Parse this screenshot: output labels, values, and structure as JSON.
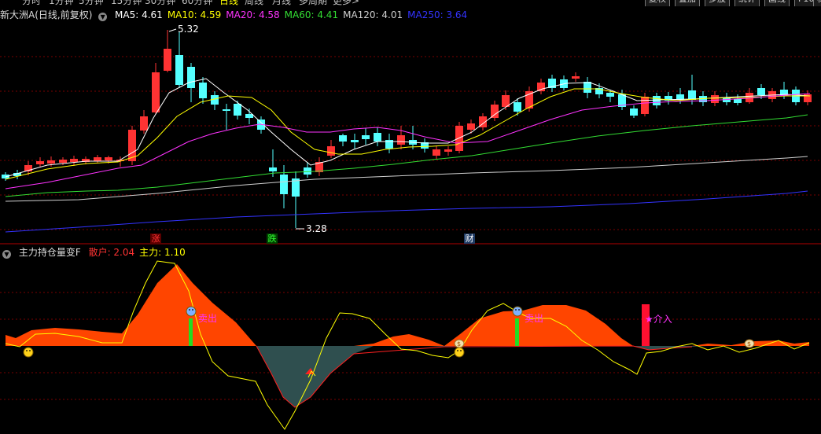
{
  "toolbar": {
    "periods": [
      "分时",
      "1分钟",
      "5分钟",
      "15分钟",
      "30分钟",
      "60分钟",
      "日线",
      "周线",
      "月线",
      "多周期",
      "更多>"
    ],
    "active_period": "日线",
    "right_buttons": [
      "复权",
      "叠加",
      "多股",
      "统计",
      "画线",
      "F10",
      "标"
    ]
  },
  "main_panel": {
    "stock_title": "新大洲A(日线,前复权)",
    "ma_legend": [
      {
        "label": "MA5: 4.61",
        "color": "#ffffff"
      },
      {
        "label": "MA10: 4.59",
        "color": "#ffff00"
      },
      {
        "label": "MA20: 4.58",
        "color": "#ff33ff"
      },
      {
        "label": "MA60: 4.41",
        "color": "#33dd33"
      },
      {
        "label": "MA120: 4.01",
        "color": "#d0d0d0"
      },
      {
        "label": "MA250: 3.64",
        "color": "#3333ff"
      }
    ],
    "high_mark": "5.32",
    "low_mark": "3.28",
    "tags": [
      {
        "text": "涨",
        "color": "#ff3333",
        "bg": "#5a0000"
      },
      {
        "text": "跌",
        "color": "#33ff33",
        "bg": "#004400"
      },
      {
        "text": "财",
        "color": "#ffffff",
        "bg": "#1f3c66"
      }
    ]
  },
  "indicator_panel": {
    "name": "主力持仓量变F",
    "values": [
      {
        "label": "散户: 2.04",
        "color": "#ff3333"
      },
      {
        "label": "主力: 1.10",
        "color": "#ffff00"
      }
    ],
    "annotations": [
      {
        "text": "卖出",
        "color": "#ff33ff"
      },
      {
        "text": "卖出",
        "color": "#ff33ff"
      },
      {
        "text": "★介入",
        "color": "#ff33ff"
      }
    ]
  },
  "colors": {
    "up_candle": "#ff3333",
    "down_candle": "#54ffff",
    "area_pos": "#ff4500",
    "area_neg": "#2f4f4f",
    "main_line": "#ffff00",
    "grid": "#7a0000",
    "divider": "#b00000"
  }
}
